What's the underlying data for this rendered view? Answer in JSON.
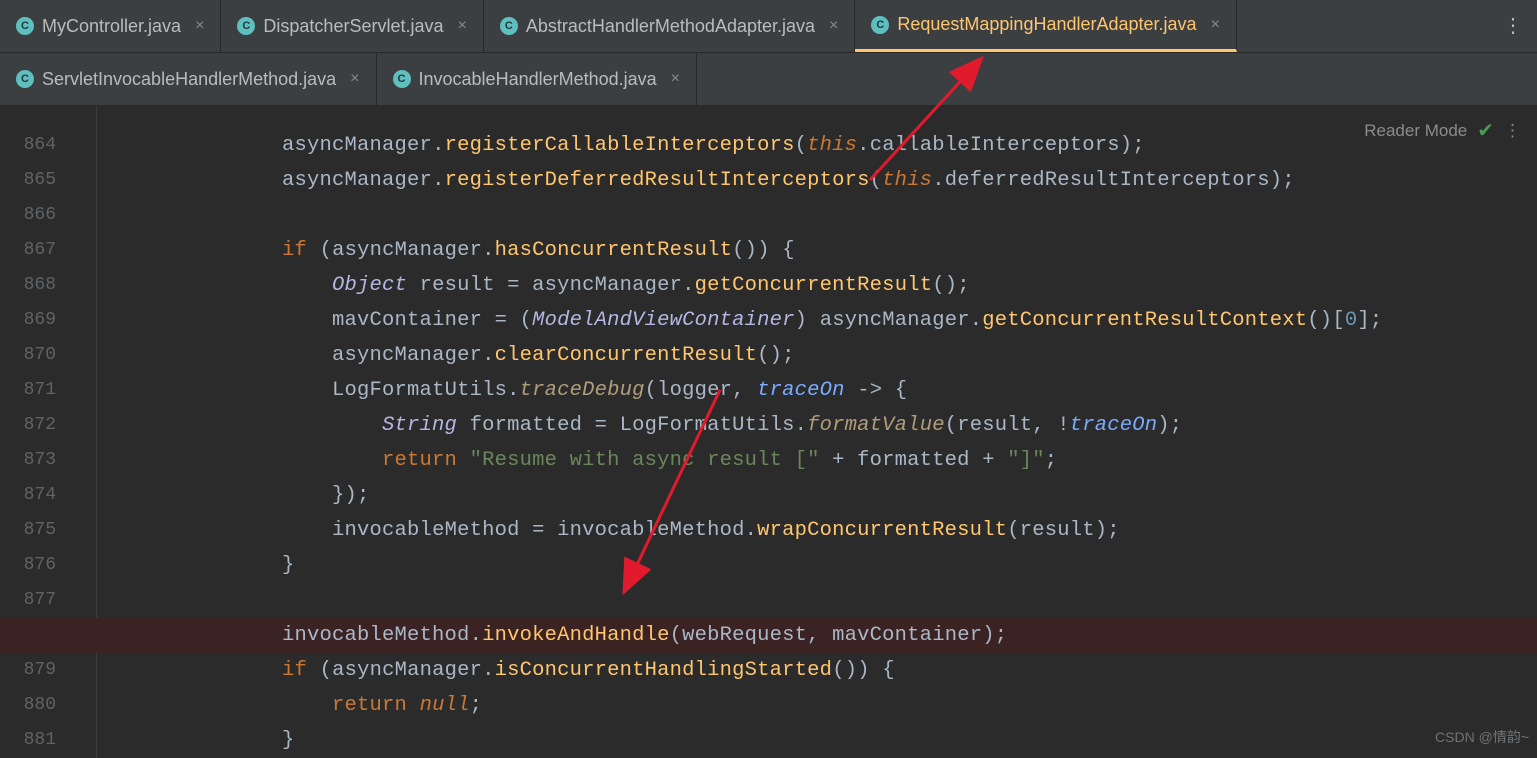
{
  "tabs_row1": [
    {
      "label": "MyController.java"
    },
    {
      "label": "DispatcherServlet.java"
    },
    {
      "label": "AbstractHandlerMethodAdapter.java"
    },
    {
      "label": "RequestMappingHandlerAdapter.java"
    }
  ],
  "tabs_row2": [
    {
      "label": "ServletInvocableHandlerMethod.java"
    },
    {
      "label": "InvocableHandlerMethod.java"
    }
  ],
  "active_tab": "RequestMappingHandlerAdapter.java",
  "reader_mode_label": "Reader Mode",
  "gutter": {
    "start": 864,
    "end": 881,
    "breakpoint_lines": [
      878
    ]
  },
  "code_lines": {
    "864": {
      "indent": 3,
      "tokens": [
        [
          "id",
          "asyncManager"
        ],
        [
          "op",
          "."
        ],
        [
          "meth",
          "registerCallableInterceptors"
        ],
        [
          "par",
          "("
        ],
        [
          "kwv",
          "this"
        ],
        [
          "op",
          "."
        ],
        [
          "id",
          "callableInterceptors"
        ],
        [
          "par",
          ")"
        ],
        [
          "op",
          ";"
        ]
      ]
    },
    "865": {
      "indent": 3,
      "tokens": [
        [
          "id",
          "asyncManager"
        ],
        [
          "op",
          "."
        ],
        [
          "meth",
          "registerDeferredResultInterceptors"
        ],
        [
          "par",
          "("
        ],
        [
          "kwv",
          "this"
        ],
        [
          "op",
          "."
        ],
        [
          "id",
          "deferredResultInterceptors"
        ],
        [
          "par",
          ")"
        ],
        [
          "op",
          ";"
        ]
      ]
    },
    "866": {
      "indent": 0,
      "tokens": []
    },
    "867": {
      "indent": 3,
      "tokens": [
        [
          "kw",
          "if"
        ],
        [
          "op",
          " "
        ],
        [
          "par",
          "("
        ],
        [
          "id",
          "asyncManager"
        ],
        [
          "op",
          "."
        ],
        [
          "meth",
          "hasConcurrentResult"
        ],
        [
          "par",
          "()"
        ],
        [
          "par",
          ")"
        ],
        [
          "op",
          " {"
        ]
      ]
    },
    "868": {
      "indent": 4,
      "tokens": [
        [
          "type2",
          "Object"
        ],
        [
          "op",
          " "
        ],
        [
          "id",
          "result"
        ],
        [
          "op",
          " = "
        ],
        [
          "id",
          "asyncManager"
        ],
        [
          "op",
          "."
        ],
        [
          "meth",
          "getConcurrentResult"
        ],
        [
          "par",
          "()"
        ],
        [
          "op",
          ";"
        ]
      ]
    },
    "869": {
      "indent": 4,
      "tokens": [
        [
          "id",
          "mavContainer"
        ],
        [
          "op",
          " = "
        ],
        [
          "par",
          "("
        ],
        [
          "castType",
          "ModelAndViewContainer"
        ],
        [
          "par",
          ")"
        ],
        [
          "op",
          " "
        ],
        [
          "id",
          "asyncManager"
        ],
        [
          "op",
          "."
        ],
        [
          "meth",
          "getConcurrentResultContext"
        ],
        [
          "par",
          "()"
        ],
        [
          "op",
          "["
        ],
        [
          "num",
          "0"
        ],
        [
          "op",
          "];"
        ]
      ]
    },
    "870": {
      "indent": 4,
      "tokens": [
        [
          "id",
          "asyncManager"
        ],
        [
          "op",
          "."
        ],
        [
          "meth",
          "clearConcurrentResult"
        ],
        [
          "par",
          "()"
        ],
        [
          "op",
          ";"
        ]
      ]
    },
    "871": {
      "indent": 4,
      "tokens": [
        [
          "id",
          "LogFormatUtils"
        ],
        [
          "op",
          "."
        ],
        [
          "methI",
          "traceDebug"
        ],
        [
          "par",
          "("
        ],
        [
          "id",
          "logger"
        ],
        [
          "op",
          ", "
        ],
        [
          "param",
          "traceOn"
        ],
        [
          "op",
          " -> {"
        ]
      ]
    },
    "872": {
      "indent": 5,
      "tokens": [
        [
          "type2",
          "String"
        ],
        [
          "op",
          " "
        ],
        [
          "id",
          "formatted"
        ],
        [
          "op",
          " = "
        ],
        [
          "id",
          "LogFormatUtils"
        ],
        [
          "op",
          "."
        ],
        [
          "methI",
          "formatValue"
        ],
        [
          "par",
          "("
        ],
        [
          "id",
          "result"
        ],
        [
          "op",
          ", !"
        ],
        [
          "param",
          "traceOn"
        ],
        [
          "par",
          ")"
        ],
        [
          "op",
          ";"
        ]
      ]
    },
    "873": {
      "indent": 5,
      "tokens": [
        [
          "kw",
          "return"
        ],
        [
          "op",
          " "
        ],
        [
          "str",
          "\"Resume with async result [\""
        ],
        [
          "op",
          " + "
        ],
        [
          "id",
          "formatted"
        ],
        [
          "op",
          " + "
        ],
        [
          "str",
          "\"]\""
        ],
        [
          "op",
          ";"
        ]
      ]
    },
    "874": {
      "indent": 4,
      "tokens": [
        [
          "op",
          "});"
        ]
      ]
    },
    "875": {
      "indent": 4,
      "tokens": [
        [
          "id",
          "invocableMethod"
        ],
        [
          "op",
          " = "
        ],
        [
          "id",
          "invocableMethod"
        ],
        [
          "op",
          "."
        ],
        [
          "meth",
          "wrapConcurrentResult"
        ],
        [
          "par",
          "("
        ],
        [
          "id",
          "result"
        ],
        [
          "par",
          ")"
        ],
        [
          "op",
          ";"
        ]
      ]
    },
    "876": {
      "indent": 3,
      "tokens": [
        [
          "op",
          "}"
        ]
      ]
    },
    "877": {
      "indent": 0,
      "tokens": []
    },
    "878": {
      "indent": 3,
      "tokens": [
        [
          "id",
          "invocableMethod"
        ],
        [
          "op",
          "."
        ],
        [
          "meth",
          "invokeAndHandle"
        ],
        [
          "par",
          "("
        ],
        [
          "id",
          "webRequest"
        ],
        [
          "op",
          ", "
        ],
        [
          "id",
          "mavContainer"
        ],
        [
          "par",
          ")"
        ],
        [
          "op",
          ";"
        ]
      ],
      "highlight": true
    },
    "879": {
      "indent": 3,
      "tokens": [
        [
          "kw",
          "if"
        ],
        [
          "op",
          " "
        ],
        [
          "par",
          "("
        ],
        [
          "id",
          "asyncManager"
        ],
        [
          "op",
          "."
        ],
        [
          "meth",
          "isConcurrentHandlingStarted"
        ],
        [
          "par",
          "()"
        ],
        [
          "par",
          ")"
        ],
        [
          "op",
          " {"
        ]
      ]
    },
    "880": {
      "indent": 4,
      "tokens": [
        [
          "kw",
          "return"
        ],
        [
          "op",
          " "
        ],
        [
          "kwv",
          "null"
        ],
        [
          "op",
          ";"
        ]
      ]
    },
    "881": {
      "indent": 3,
      "tokens": [
        [
          "op",
          "}"
        ]
      ]
    }
  },
  "watermark": "CSDN @情韵~",
  "icon_letter": "C"
}
